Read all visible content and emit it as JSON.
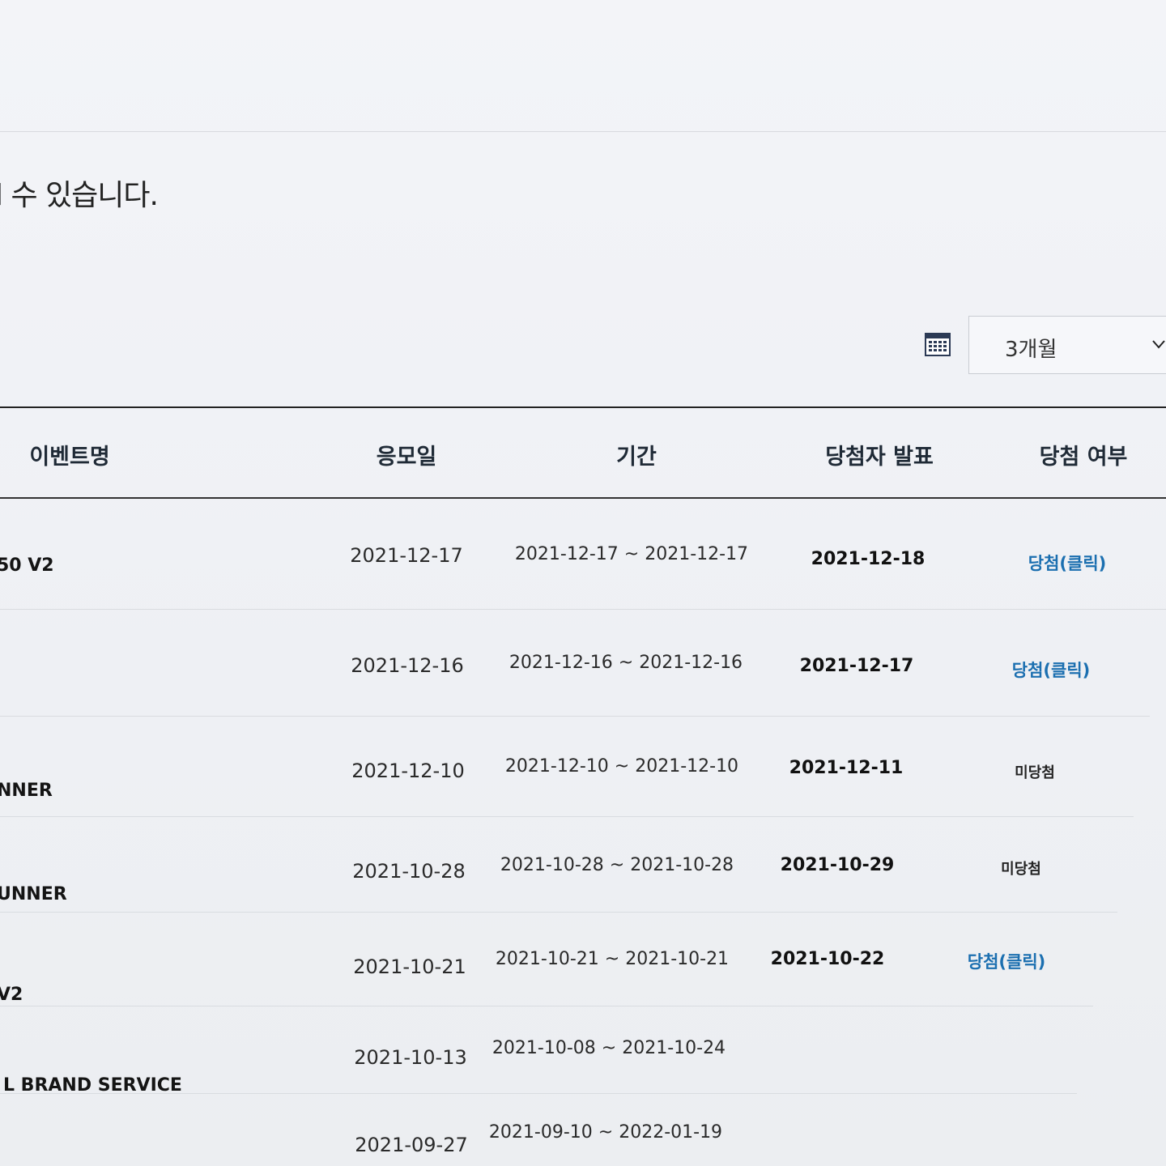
{
  "notice": "l 수 있습니다.",
  "filter": {
    "calendar_icon": "calendar-icon",
    "period_value": "3개월",
    "chevron_icon": "chevron-down-icon"
  },
  "table": {
    "headers": {
      "event_name": "이벤트명",
      "entry_date": "응모일",
      "period": "기간",
      "winner_announce": "당첨자 발표",
      "win_status": "당첨 여부"
    },
    "rows": [
      {
        "name": "50 V2",
        "entry_date": "2021-12-17",
        "period": "2021-12-17 ~ 2021-12-17",
        "announce": "2021-12-18",
        "status": "당첨(클릭)",
        "status_type": "win"
      },
      {
        "name": "",
        "entry_date": "2021-12-16",
        "period": "2021-12-16 ~ 2021-12-16",
        "announce": "2021-12-17",
        "status": "당첨(클릭)",
        "status_type": "win"
      },
      {
        "name": "NNER",
        "entry_date": "2021-12-10",
        "period": "2021-12-10 ~ 2021-12-10",
        "announce": "2021-12-11",
        "status": "미당첨",
        "status_type": "lose"
      },
      {
        "name": "UNNER",
        "entry_date": "2021-10-28",
        "period": "2021-10-28 ~ 2021-10-28",
        "announce": "2021-10-29",
        "status": "미당첨",
        "status_type": "lose"
      },
      {
        "name": "V2",
        "entry_date": "2021-10-21",
        "period": "2021-10-21 ~ 2021-10-21",
        "announce": "2021-10-22",
        "status": "당첨(클릭)",
        "status_type": "win"
      },
      {
        "name": "L BRAND SERVICE",
        "entry_date": "2021-10-13",
        "period": "2021-10-08 ~ 2021-10-24",
        "announce": "",
        "status": "",
        "status_type": "none"
      },
      {
        "name": "",
        "entry_date": "2021-09-27",
        "period": "2021-09-10 ~ 2022-01-19",
        "announce": "",
        "status": "",
        "status_type": "none"
      }
    ]
  },
  "colors": {
    "win_link": "#1b6fb0",
    "header_text": "#1f2a36"
  }
}
